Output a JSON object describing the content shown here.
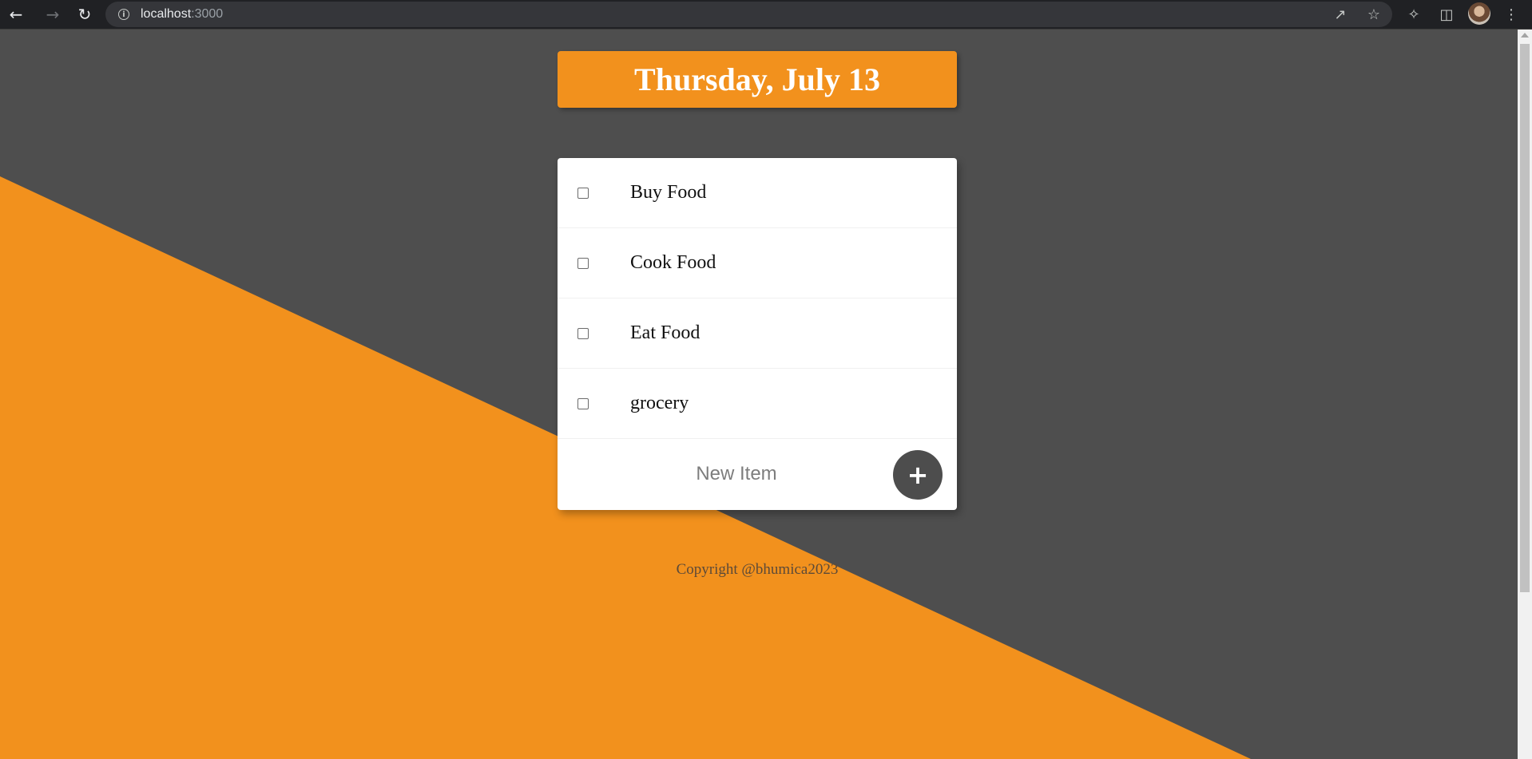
{
  "browser": {
    "url_host": "localhost",
    "url_port": ":3000",
    "back_icon": "back-arrow-icon",
    "forward_icon": "forward-arrow-icon",
    "reload_icon": "reload-icon",
    "info_icon": "info-icon",
    "share_icon": "share-icon",
    "bookmark_icon": "star-icon",
    "extensions_icon": "puzzle-icon",
    "sidepanel_icon": "side-panel-icon",
    "menu_icon": "kebab-menu-icon"
  },
  "colors": {
    "page_background": "#4e4e4e",
    "accent_orange": "#f2911d",
    "card_background": "#ffffff",
    "add_button": "#4d4d4d"
  },
  "heading": {
    "date": "Thursday, July 13"
  },
  "todo": {
    "items": [
      {
        "label": "Buy Food",
        "checked": false
      },
      {
        "label": "Cook Food",
        "checked": false
      },
      {
        "label": "Eat Food",
        "checked": false
      },
      {
        "label": "grocery",
        "checked": false
      }
    ],
    "new_item_placeholder": "New Item",
    "add_button_label": "+"
  },
  "footer": {
    "copyright": "Copyright @bhumica2023"
  }
}
